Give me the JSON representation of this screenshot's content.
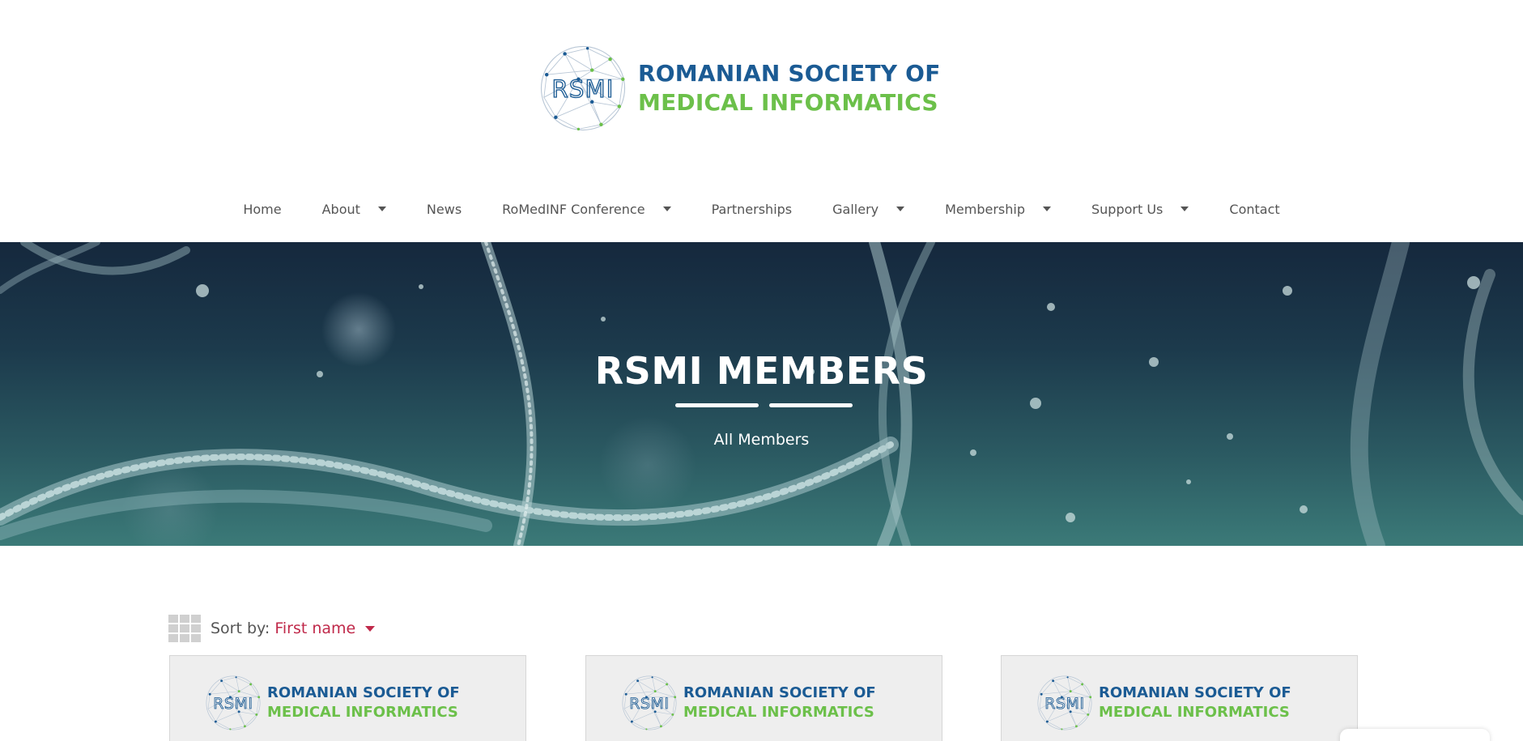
{
  "header": {
    "logo_monogram": "RSMI",
    "logo_line1": "ROMANIAN SOCIETY OF",
    "logo_line2": "MEDICAL INFORMATICS",
    "brand_blue": "#1b5b94",
    "brand_green": "#6cc04a"
  },
  "nav": {
    "items": [
      {
        "label": "Home",
        "has_dropdown": false
      },
      {
        "label": "About",
        "has_dropdown": true
      },
      {
        "label": "News",
        "has_dropdown": false
      },
      {
        "label": "RoMedINF Conference",
        "has_dropdown": true
      },
      {
        "label": "Partnerships",
        "has_dropdown": false
      },
      {
        "label": "Gallery",
        "has_dropdown": true
      },
      {
        "label": "Membership",
        "has_dropdown": true
      },
      {
        "label": "Support Us",
        "has_dropdown": true
      },
      {
        "label": "Contact",
        "has_dropdown": false
      }
    ],
    "caret_icon": "caret-down-icon"
  },
  "hero": {
    "title": "RSMI MEMBERS",
    "subtitle": "All Members",
    "background": "dna-helix-image"
  },
  "members": {
    "view_icon": "grid-view-icon",
    "sort_label": "Sort by:",
    "sort_value": "First name",
    "accent_color": "#c0294a",
    "cards": [
      {
        "logo_line1": "ROMANIAN SOCIETY OF",
        "logo_line2": "MEDICAL INFORMATICS",
        "monogram": "RSMI"
      },
      {
        "logo_line1": "ROMANIAN SOCIETY OF",
        "logo_line2": "MEDICAL INFORMATICS",
        "monogram": "RSMI"
      },
      {
        "logo_line1": "ROMANIAN SOCIETY OF",
        "logo_line2": "MEDICAL INFORMATICS",
        "monogram": "RSMI"
      }
    ]
  }
}
